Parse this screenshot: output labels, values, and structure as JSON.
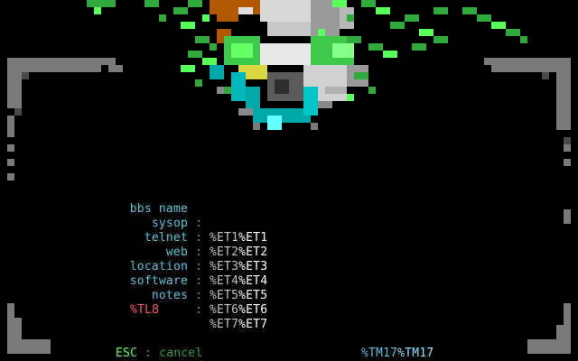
{
  "fields": [
    {
      "label": "bbs name",
      "value_a": "%ET1",
      "value_b": "%ET1"
    },
    {
      "label": "sysop",
      "value_a": "%ET2",
      "value_b": "%ET2"
    },
    {
      "label": "telnet",
      "value_a": "%ET3",
      "value_b": "%ET3"
    },
    {
      "label": "web",
      "value_a": "%ET4",
      "value_b": "%ET4"
    },
    {
      "label": "location",
      "value_a": "%ET5",
      "value_b": "%ET5"
    },
    {
      "label": "software",
      "value_a": "%ET6",
      "value_b": "%ET6"
    },
    {
      "label": "notes",
      "value_a": "%ET7",
      "value_b": "%ET7"
    }
  ],
  "separator": ":",
  "error_code": "%TL8",
  "footer": {
    "key": "ESC",
    "separator": ":",
    "action": "cancel",
    "tm_a": "%TM17",
    "tm_b": "%TM17"
  },
  "colors": {
    "background": "#000000",
    "label": "#54c6d8",
    "value_primary": "#c0c0c0",
    "value_secondary": "#ffffff",
    "error": "#ff5555",
    "esc_key": "#55ff55",
    "border_gray": "#808080",
    "skull_green": "#33cc33",
    "skull_cyan": "#00a8a8"
  }
}
